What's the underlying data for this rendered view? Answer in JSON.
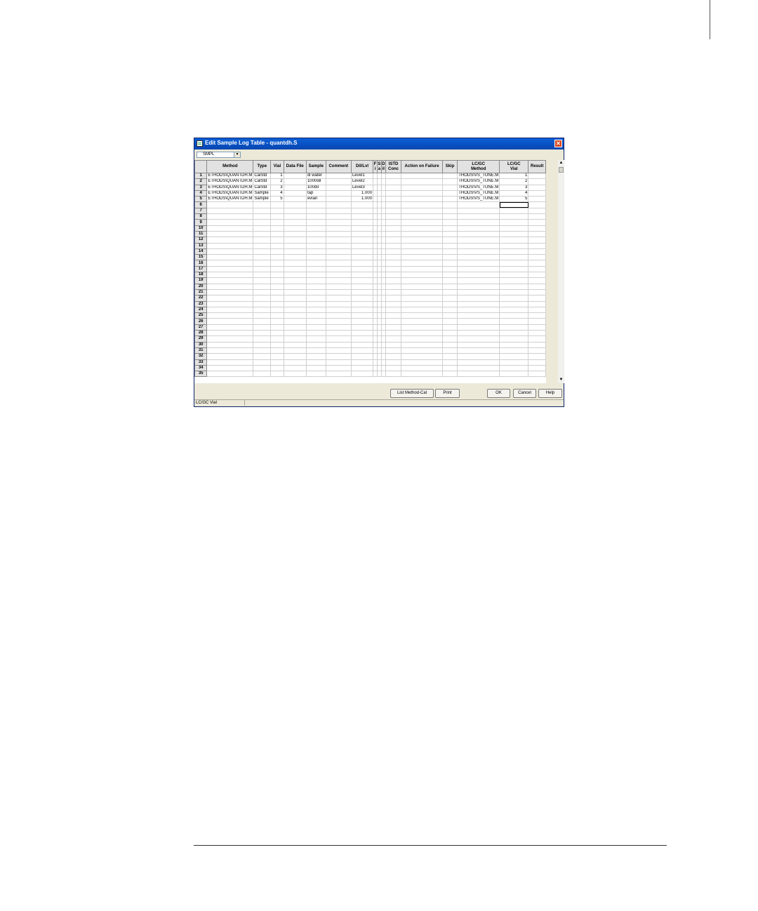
{
  "window": {
    "title": "Edit Sample Log Table - quantdh.S",
    "close_glyph": "✕"
  },
  "mode_dropdown": {
    "value": "SMPL",
    "arrow": "▼"
  },
  "table": {
    "columns": [
      "",
      "Method",
      "Type",
      "Vial",
      "Data File",
      "Sample",
      "Comment",
      "Dil/Lvl",
      "F\ni",
      "S\na",
      "D\nil",
      "ISTD\nConc",
      "Action on Failure",
      "Skip",
      "LC/GC\nMethod",
      "LC/GC\nVial",
      "Result"
    ],
    "rows": [
      [
        "1",
        "ETHODS\\QUANTDH.M",
        "CalStd",
        "1",
        "",
        "di water",
        "",
        "Level1",
        "",
        "",
        "",
        "",
        "",
        "",
        "THODS\\VS_TUNE.M",
        "1",
        ""
      ],
      [
        "2",
        "ETHODS\\QUANTDH.M",
        "CalStd",
        "2",
        "",
        "1000dil",
        "",
        "Level2",
        "",
        "",
        "",
        "",
        "",
        "",
        "THODS\\VS_TUNE.M",
        "2",
        ""
      ],
      [
        "3",
        "ETHODS\\QUANTDH.M",
        "CalStd",
        "3",
        "",
        "100dil",
        "",
        "Level3",
        "",
        "",
        "",
        "",
        "",
        "",
        "THODS\\VS_TUNE.M",
        "3",
        ""
      ],
      [
        "4",
        "ETHODS\\QUANTDH.M",
        "Sample",
        "4",
        "",
        "tap",
        "",
        "1.000",
        "",
        "",
        "",
        "",
        "",
        "",
        "THODS\\VS_TUNE.M",
        "4",
        ""
      ],
      [
        "5",
        "ETHODS\\QUANTDH.M",
        "Sample",
        "5",
        "",
        "evian",
        "",
        "1.000",
        "",
        "",
        "",
        "",
        "",
        "",
        "THODS\\VS_TUNE.M",
        "5",
        ""
      ]
    ],
    "total_rows": 35
  },
  "buttons": {
    "list_method_cal": "List Method-Cal",
    "print": "Print",
    "ok": "OK",
    "cancel": "Cancel",
    "help": "Help"
  },
  "scrollbar": {
    "up": "▲",
    "down": "▼"
  },
  "status_bar": {
    "text": "LC/GC Vial"
  }
}
